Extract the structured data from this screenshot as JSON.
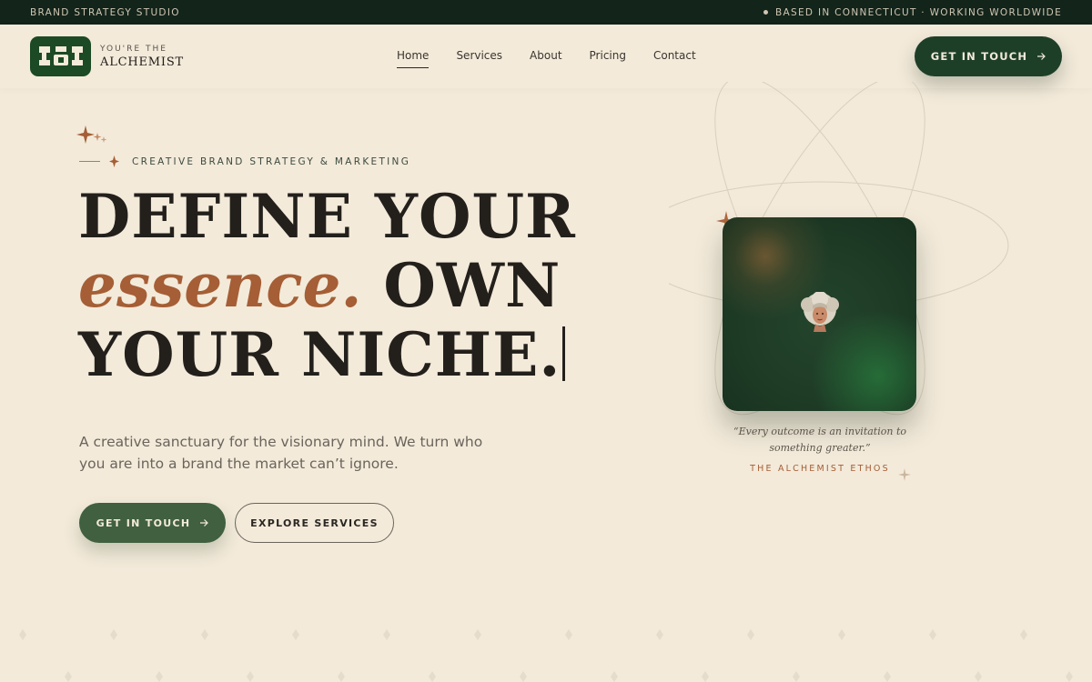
{
  "topbar": {
    "left_text": "BRAND STRATEGY STUDIO",
    "right_text": "BASED IN CONNECTICUT · WORKING WORLDWIDE"
  },
  "header": {
    "logo": {
      "small_text": "YOU'RE THE",
      "big_text": "ALCHEMIST"
    },
    "nav": [
      {
        "label": "Home",
        "active": true
      },
      {
        "label": "Services"
      },
      {
        "label": "About"
      },
      {
        "label": "Pricing"
      },
      {
        "label": "Contact"
      }
    ],
    "cta": {
      "label": "GET IN TOUCH",
      "icon": "arrow-right-icon"
    }
  },
  "hero": {
    "eyebrow": "CREATIVE BRAND STRATEGY & MARKETING",
    "headline": {
      "line1": "DEFINE YOUR",
      "line2_em": "essence.",
      "line2_rest": "OWN",
      "line3": "YOUR NICHE."
    },
    "subtext": "A creative sanctuary for the visionary mind. We turn who you are into a brand the market can’t ignore.",
    "buttons": {
      "primary": "GET IN TOUCH",
      "secondary": "EXPLORE SERVICES"
    }
  },
  "visual": {
    "quote": "“Every outcome is an invitation to something greater.”",
    "attribution": "THE ALCHEMIST ETHOS"
  },
  "colors": {
    "background": "#f3eada",
    "topbar": "#13241a",
    "brand_green": "#1d3f28",
    "button_green": "#40603f",
    "accent": "#a55e35"
  }
}
